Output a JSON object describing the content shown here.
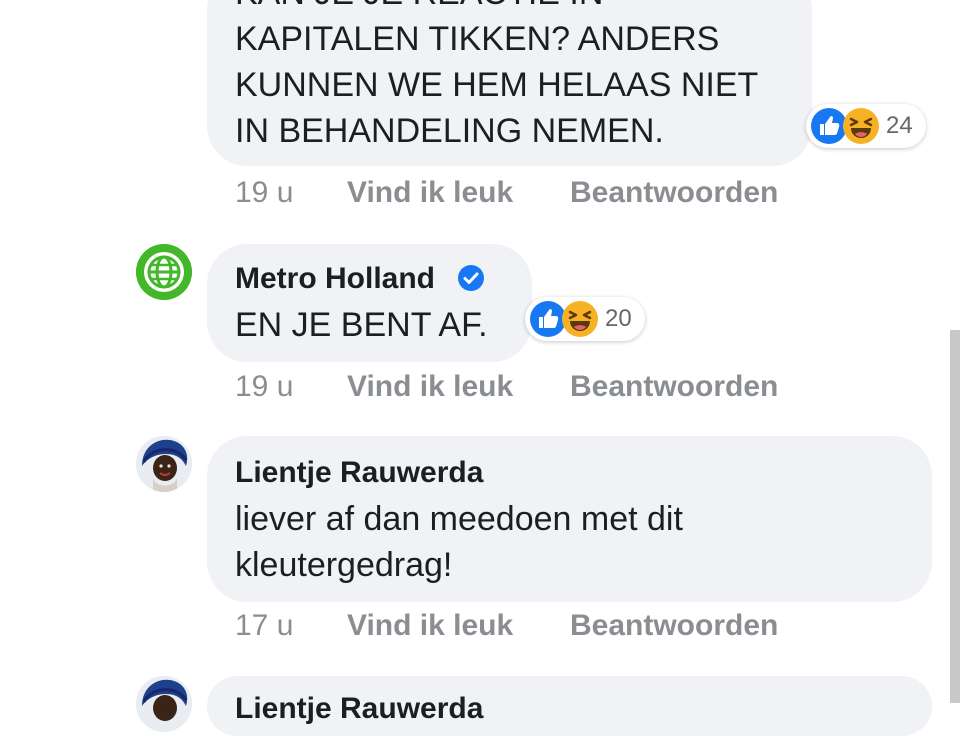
{
  "comments": [
    {
      "lines": [
        "KAN JE JE REACTIE IN",
        "KAPITALEN TIKKEN? ANDERS",
        "KUNNEN WE HEM HELAAS NIET",
        "IN BEHANDELING NEMEN."
      ],
      "reaction_count": "24",
      "time": "19 u",
      "like_label": "Vind ik leuk",
      "reply_label": "Beantwoorden"
    },
    {
      "author": "Metro Holland",
      "verified": true,
      "lines": [
        "EN JE BENT AF."
      ],
      "reaction_count": "20",
      "time": "19 u",
      "like_label": "Vind ik leuk",
      "reply_label": "Beantwoorden",
      "avatar_color": "#42b72a"
    },
    {
      "author": "Lientje Rauwerda",
      "lines": [
        "liever af dan meedoen met dit",
        "kleutergedrag!"
      ],
      "time": "17 u",
      "like_label": "Vind ik leuk",
      "reply_label": "Beantwoorden"
    },
    {
      "author": "Lientje Rauwerda"
    }
  ],
  "colors": {
    "bubble": "#f0f2f5",
    "meta": "#8a8d91",
    "like_blue": "#1877f2",
    "haha_yellow": "#f7b125",
    "verified": "#1877f2"
  }
}
